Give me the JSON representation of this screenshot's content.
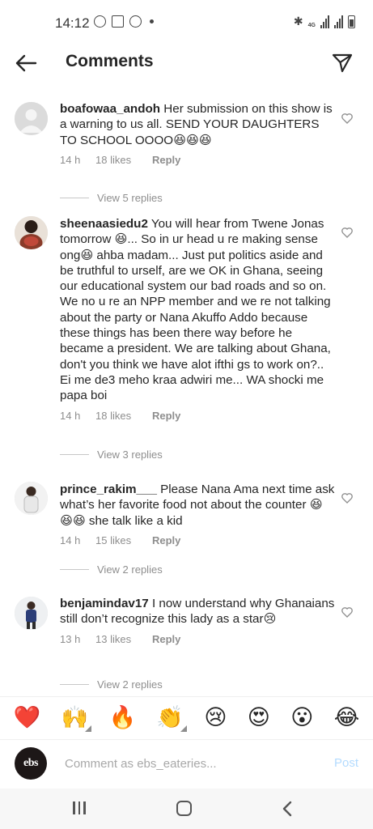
{
  "status_bar": {
    "time": "14:12",
    "network": "4G"
  },
  "header": {
    "title": "Comments"
  },
  "comments": [
    {
      "username": "boafowaa_andoh",
      "text": "Her submission on this show is a warning to us all. SEND YOUR DAUGHTERS TO SCHOOL OOOO😆😆😆",
      "time": "14 h",
      "likes": "18 likes",
      "reply_label": "Reply",
      "view_replies": "View 5 replies"
    },
    {
      "username": "sheenaasiedu2",
      "text": "You will hear from Twene Jonas tomorrow 😆... So in ur head u re making sense ong😆 ahba madam... Just put politics aside and be truthful to urself, are we OK in Ghana, seeing our educational system our bad roads and so on. We no u re an NPP member and we re not talking about the party or Nana Akuffo Addo because these things has been there way before he became a president. We are talking about Ghana, don't you think we have alot ifthi gs to work on?.. Ei me de3 meho kraa adwiri me... WA shocki me papa boi",
      "time": "14 h",
      "likes": "18 likes",
      "reply_label": "Reply",
      "view_replies": "View 3 replies"
    },
    {
      "username": "prince_rakim___",
      "text": "Please Nana Ama next time ask what’s her favorite food not about the counter 😆😆😆 she talk like a kid",
      "time": "14 h",
      "likes": "15 likes",
      "reply_label": "Reply",
      "view_replies": "View 2 replies"
    },
    {
      "username": "benjamindav17",
      "text": "I now understand why Ghanaians still don’t recognize this lady as a star😢",
      "time": "13 h",
      "likes": "13 likes",
      "reply_label": "Reply",
      "view_replies": "View 2 replies"
    }
  ],
  "emoji_bar": [
    "❤️",
    "🙌",
    "🔥",
    "👏",
    "😢",
    "😍",
    "😮",
    "😂"
  ],
  "comment_input": {
    "avatar_text": "ebs",
    "placeholder": "Comment as ebs_eateries...",
    "post_label": "Post"
  },
  "colors": {
    "text": "#262626",
    "secondary": "#8e8e8e",
    "post_disabled": "#b3dbff"
  }
}
